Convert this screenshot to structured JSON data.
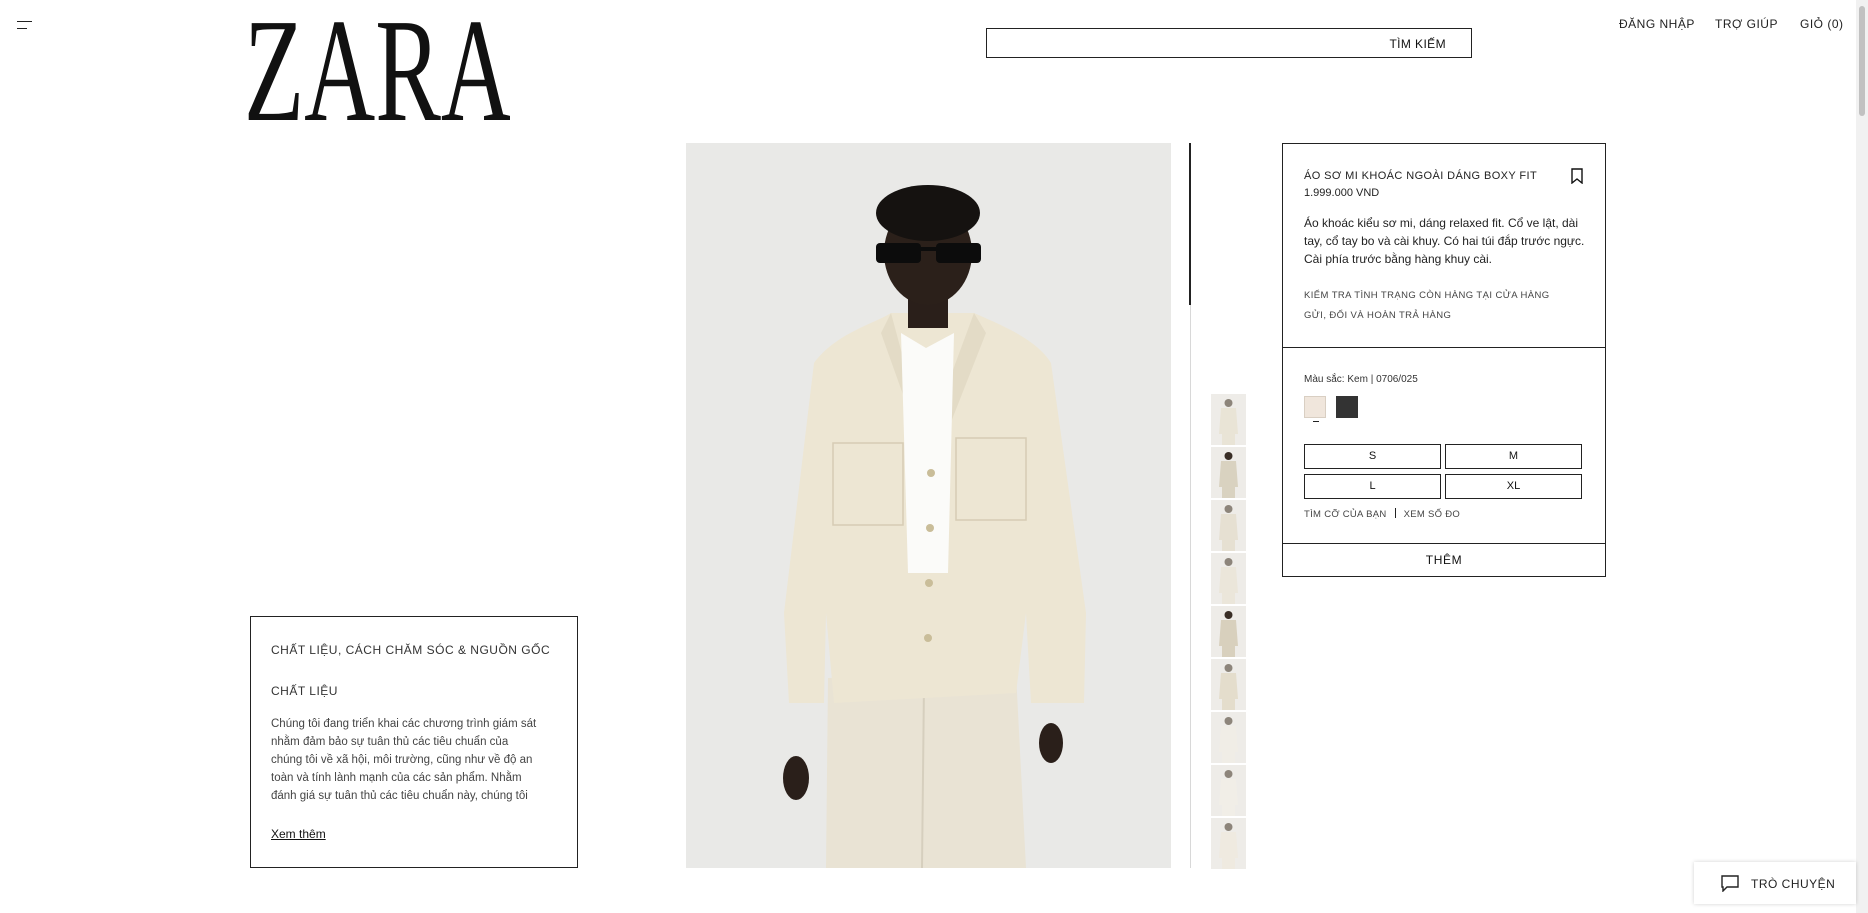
{
  "header": {
    "logo_text": "ZARA",
    "search_label": "TÌM KIẾM",
    "links": [
      "ĐĂNG NHẬP",
      "TRỢ GIÚP",
      "GIỎ (0)"
    ]
  },
  "materials": {
    "title": "CHẤT LIỆU, CÁCH CHĂM SÓC & NGUỒN GỐC",
    "subtitle": "CHẤT LIỆU",
    "text": "Chúng tôi đang triển khai các chương trình giám sát nhằm đảm bảo sự tuân thủ các tiêu chuẩn của chúng tôi về xã hội, môi trường, cũng như về độ an toàn và tính lành mạnh của các sản phẩm. Nhằm đánh giá sự tuân thủ các tiêu chuẩn này, chúng tôi",
    "more_link": "Xem thêm"
  },
  "product": {
    "title": "ÁO SƠ MI KHOÁC NGOÀI DÁNG BOXY FIT",
    "price": "1.999.000 VND",
    "description": "Áo khoác kiểu sơ mi, dáng relaxed fit. Cổ ve lật, dài tay, cổ tay bo và cài khuy. Có hai túi đắp trước ngực. Cài phía trước bằng hàng khuy cài.",
    "links": [
      "KIỂM TRA TÌNH TRẠNG CÒN HÀNG TẠI CỬA HÀNG",
      "GỬI, ĐỔI VÀ HOÀN TRẢ HÀNG"
    ],
    "color_label": "Màu sắc: Kem | 0706/025",
    "colors": [
      "#f0e6dc",
      "#333333"
    ],
    "sizes": [
      "S",
      "M",
      "L",
      "XL"
    ],
    "find_size": "TÌM CỠ CỦA BẠN",
    "size_chart": "XEM SỐ ĐO",
    "add_button": "THÊM"
  },
  "chat": {
    "label": "TRÒ CHUYỆN"
  },
  "thumbnail_count": 9
}
